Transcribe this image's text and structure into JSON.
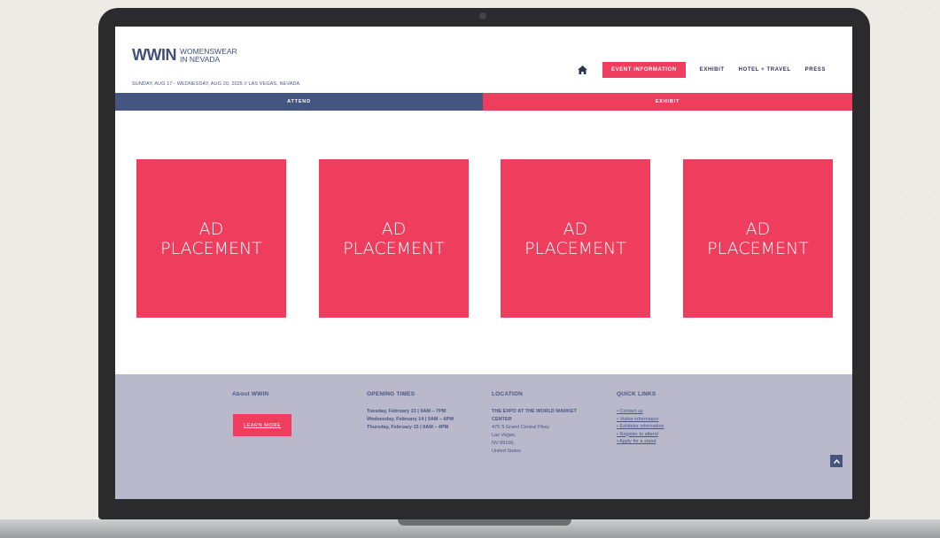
{
  "logo": {
    "mark": "WWIN",
    "text_line1": "WOMENSWEAR",
    "text_line2": "IN NEVADA"
  },
  "header": {
    "dates": "SUNDAY, AUG 17 - WEDNESDAY, AUG 20, 2025 // LAS VEGAS, NEVADA"
  },
  "nav": {
    "home_icon": "home-icon",
    "items": [
      "EVENT INFORMATION",
      "EXHIBIT",
      "HOTEL + TRAVEL",
      "PRESS"
    ]
  },
  "subnav": {
    "attend": "ATTEND",
    "exhibit": "EXHIBIT"
  },
  "ads": [
    {
      "line1": "AD",
      "line2": "PLACEMENT"
    },
    {
      "line1": "AD",
      "line2": "PLACEMENT"
    },
    {
      "line1": "AD",
      "line2": "PLACEMENT"
    },
    {
      "line1": "AD",
      "line2": "PLACEMENT"
    }
  ],
  "footer": {
    "about": {
      "heading": "About WWIN",
      "button": "LEARN MORE"
    },
    "opening": {
      "heading": "OPENING TIMES",
      "lines": [
        "Tuesday, February 13 | 9AM – 7PM",
        "Wednesday, February 14 | 9AM – 6PM",
        "Thursday, February 15 | 9AM – 4PM"
      ]
    },
    "location": {
      "heading": "LOCATION",
      "venue_line1": "THE EXPO AT THE WORLD MARKET",
      "venue_line2": "CENTER",
      "address": [
        "475 S Grand Central Pkwy",
        "Las Vegas,",
        "NV 89106,",
        "United States"
      ]
    },
    "quick_links": {
      "heading": "QUICK LINKS",
      "items": [
        "Contact us",
        "Visitor information",
        "Exhibitor information",
        "Register to attend",
        "Apply for a stand"
      ]
    }
  },
  "colors": {
    "accent": "#ee3d5d",
    "navy": "#44557f",
    "footer_bg": "#bab8cb"
  }
}
